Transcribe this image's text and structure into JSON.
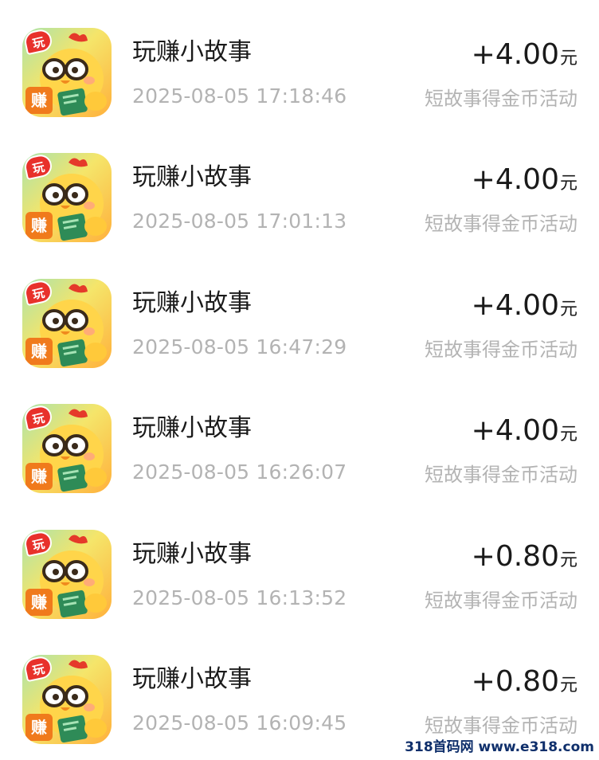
{
  "items": [
    {
      "title": "玩赚小故事",
      "time": "2025-08-05 17:18:46",
      "amount": "+4.00",
      "unit": "元",
      "desc": "短故事得金币活动"
    },
    {
      "title": "玩赚小故事",
      "time": "2025-08-05 17:01:13",
      "amount": "+4.00",
      "unit": "元",
      "desc": "短故事得金币活动"
    },
    {
      "title": "玩赚小故事",
      "time": "2025-08-05 16:47:29",
      "amount": "+4.00",
      "unit": "元",
      "desc": "短故事得金币活动"
    },
    {
      "title": "玩赚小故事",
      "time": "2025-08-05 16:26:07",
      "amount": "+4.00",
      "unit": "元",
      "desc": "短故事得金币活动"
    },
    {
      "title": "玩赚小故事",
      "time": "2025-08-05 16:13:52",
      "amount": "+0.80",
      "unit": "元",
      "desc": "短故事得金币活动"
    },
    {
      "title": "玩赚小故事",
      "time": "2025-08-05 16:09:45",
      "amount": "+0.80",
      "unit": "元",
      "desc": "短故事得金币活动"
    }
  ],
  "app_icon": {
    "name": "chick-reading-app-icon",
    "badge_top": "玩",
    "badge_bottom": "赚"
  },
  "watermark": "318首码网 www.e318.com"
}
